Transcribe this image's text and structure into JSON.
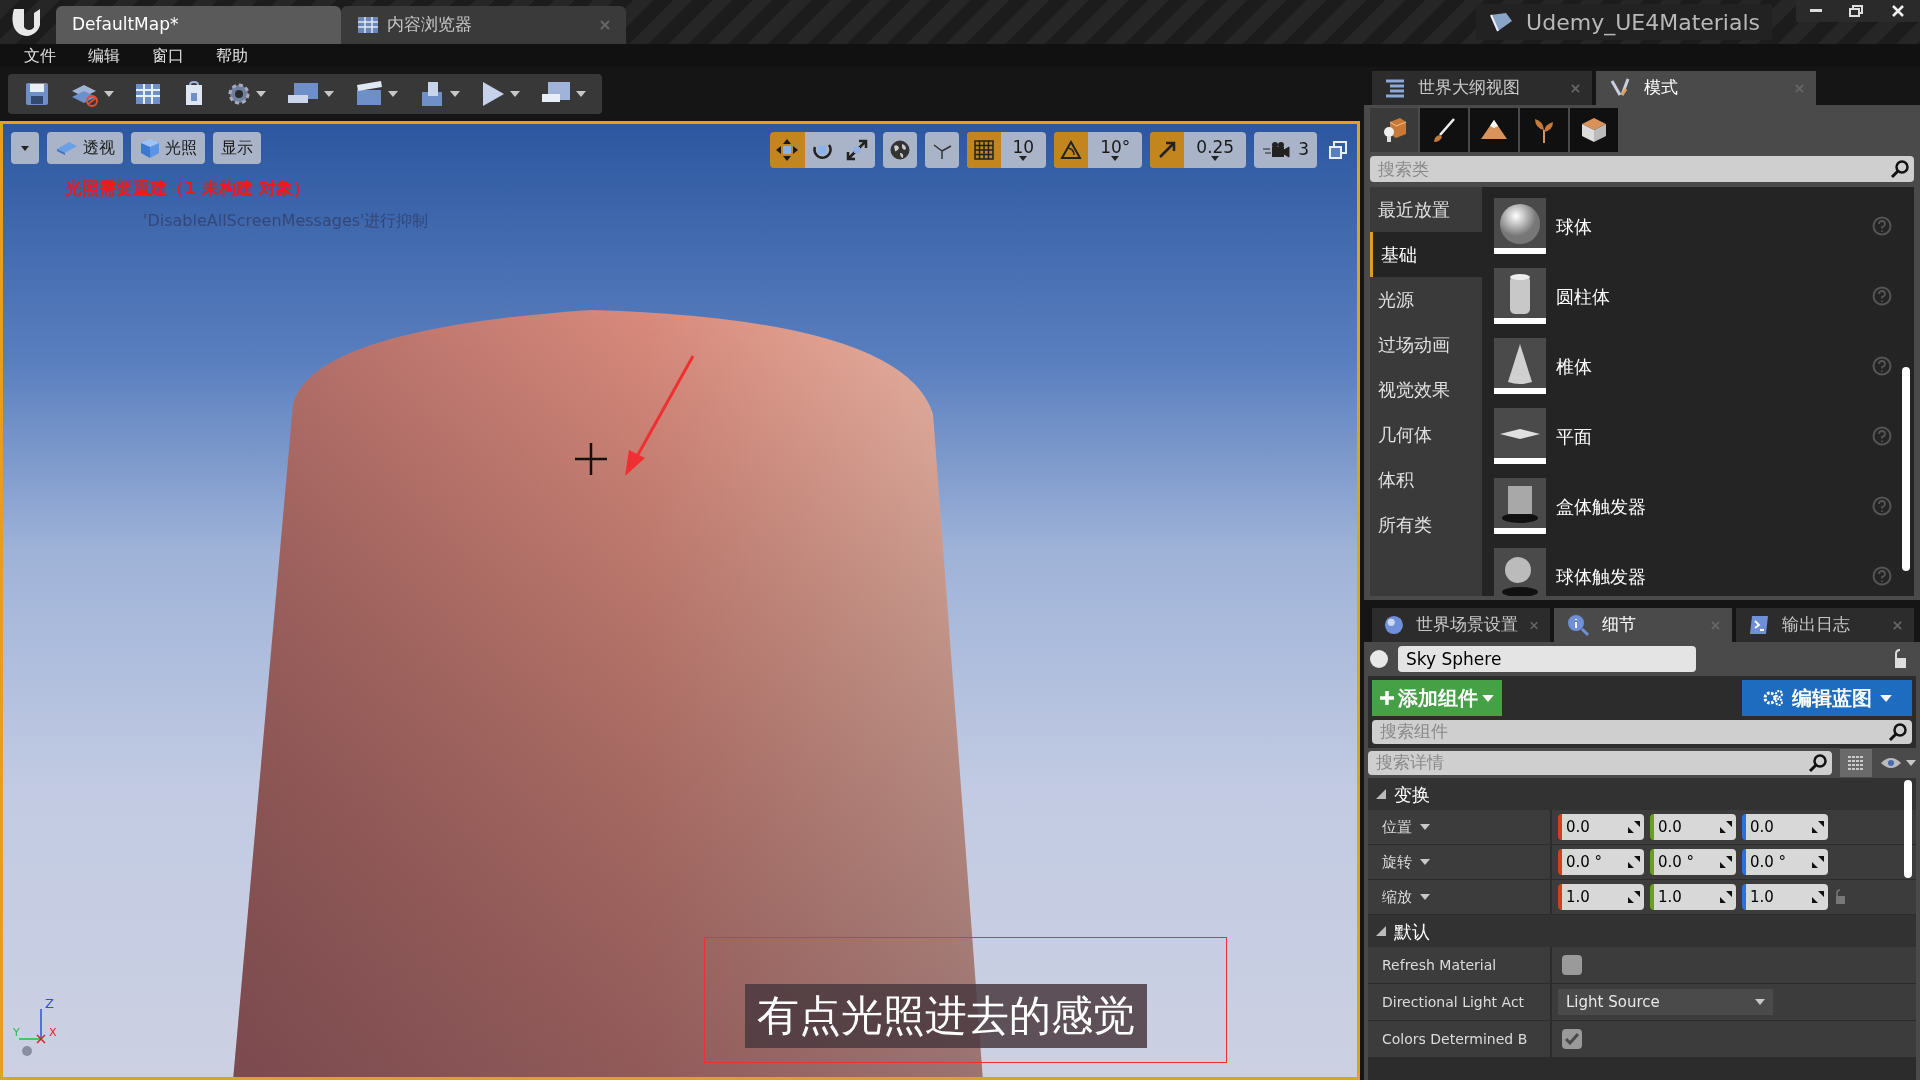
{
  "window": {
    "tabs": [
      {
        "label": "DefaultMap*",
        "selected": true
      },
      {
        "label": "内容浏览器",
        "selected": false
      }
    ],
    "project": "Udemy_UE4Materials"
  },
  "menu": [
    "文件",
    "编辑",
    "窗口",
    "帮助"
  ],
  "toolbar": [
    {
      "kind": "save",
      "dropdown": false
    },
    {
      "kind": "source",
      "dropdown": true
    },
    {
      "kind": "content",
      "dropdown": false
    },
    {
      "kind": "market",
      "dropdown": false
    },
    {
      "kind": "settings",
      "dropdown": true
    },
    {
      "kind": "blueprints",
      "dropdown": true
    },
    {
      "kind": "cinematics",
      "dropdown": true
    },
    {
      "kind": "build",
      "dropdown": true
    },
    {
      "kind": "play",
      "dropdown": true
    },
    {
      "kind": "launch",
      "dropdown": true
    }
  ],
  "viewport": {
    "view_buttons": [
      {
        "kind": "perspective",
        "label": "透视"
      },
      {
        "kind": "lit",
        "label": "光照"
      },
      {
        "kind": "show",
        "label": "显示"
      }
    ],
    "transform_tools": [
      {
        "kind": "move",
        "selected": true
      },
      {
        "kind": "rotate",
        "selected": false
      },
      {
        "kind": "scale",
        "selected": false
      }
    ],
    "snaps": [
      {
        "kind": "grid",
        "on": true,
        "value": "10"
      },
      {
        "kind": "rotation",
        "on": true,
        "value": "10°"
      },
      {
        "kind": "scale",
        "on": true,
        "value": "0.25"
      }
    ],
    "camera_speed": "3",
    "warning": "光照需要重建（1 未构建 对象）",
    "faded_message": "'DisableAllScreenMessages'进行抑制",
    "axis_labels": [
      "Z",
      "Y",
      "X"
    ],
    "subtitle": "有点光照进去的感觉"
  },
  "upper_panel": {
    "tabs": [
      {
        "label": "世界大纲视图",
        "kind": "outliner",
        "selected": false
      },
      {
        "label": "模式",
        "kind": "modes",
        "selected": true
      }
    ],
    "modes": [
      {
        "kind": "place",
        "selected": true
      },
      {
        "kind": "paint",
        "selected": false
      },
      {
        "kind": "landscape",
        "selected": false
      },
      {
        "kind": "foliage",
        "selected": false
      },
      {
        "kind": "geometry",
        "selected": false
      }
    ],
    "search_placeholder": "搜索类",
    "categories": [
      {
        "label": "最近放置",
        "selected": false
      },
      {
        "label": "基础",
        "selected": true
      },
      {
        "label": "光源",
        "selected": false
      },
      {
        "label": "过场动画",
        "selected": false
      },
      {
        "label": "视觉效果",
        "selected": false
      },
      {
        "label": "几何体",
        "selected": false
      },
      {
        "label": "体积",
        "selected": false
      },
      {
        "label": "所有类",
        "selected": false
      }
    ],
    "items": [
      {
        "label": "球体",
        "kind": "sphere"
      },
      {
        "label": "圆柱体",
        "kind": "cylinder"
      },
      {
        "label": "椎体",
        "kind": "cone"
      },
      {
        "label": "平面",
        "kind": "plane"
      },
      {
        "label": "盒体触发器",
        "kind": "box_trigger"
      },
      {
        "label": "球体触发器",
        "kind": "sphere_trigger"
      }
    ]
  },
  "details_panel": {
    "tabs": [
      {
        "label": "世界场景设置",
        "kind": "world",
        "selected": false
      },
      {
        "label": "细节",
        "kind": "details",
        "selected": true
      },
      {
        "label": "输出日志",
        "kind": "log",
        "selected": false
      }
    ],
    "actor_name": "Sky Sphere",
    "add_button": "添加组件",
    "blueprint_button": "编辑蓝图",
    "component_search_placeholder": "搜索组件",
    "detail_search_placeholder": "搜索详情",
    "sections": [
      {
        "title": "变换",
        "expanded": true,
        "rows": [
          {
            "kind": "vector",
            "label": "位置",
            "values": [
              "0.0",
              "0.0",
              "0.0"
            ]
          },
          {
            "kind": "vector",
            "label": "旋转",
            "values": [
              "0.0 °",
              "0.0 °",
              "0.0 °"
            ]
          },
          {
            "kind": "vector",
            "label": "缩放",
            "values": [
              "1.0",
              "1.0",
              "1.0"
            ]
          }
        ]
      },
      {
        "title": "默认",
        "expanded": true,
        "rows": [
          {
            "kind": "checkbox",
            "label": "Refresh Material",
            "checked": false
          },
          {
            "kind": "dropdown",
            "label": "Directional Light Act",
            "value": "Light Source"
          },
          {
            "kind": "checkbox",
            "label": "Colors Determined B",
            "checked": true
          }
        ]
      }
    ]
  }
}
